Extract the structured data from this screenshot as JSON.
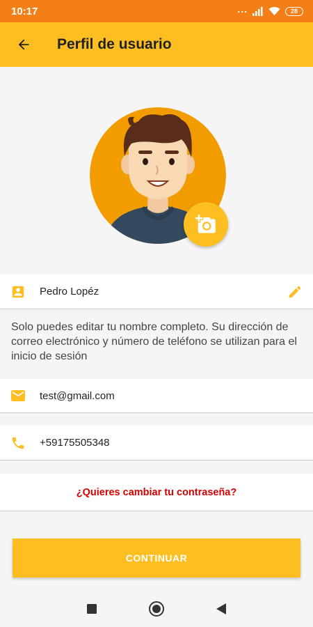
{
  "status_bar": {
    "time": "10:17",
    "dots": "...",
    "battery": "28"
  },
  "app_bar": {
    "title": "Perfil de usuario"
  },
  "profile": {
    "name": "Pedro Lopéz",
    "note": "Solo puedes editar tu nombre completo. Su dirección de correo electrónico y número de teléfono se utilizan para el inicio de sesión",
    "email": "test@gmail.com",
    "phone": "+59175505348"
  },
  "change_password_link": "¿Quieres cambiar tu contraseña?",
  "continue_button": "CONTINUAR",
  "icons": {
    "back": "arrow-back-icon",
    "camera": "add-a-photo-icon",
    "name": "contact-card-icon",
    "edit": "pencil-icon",
    "email": "mail-icon",
    "phone": "phone-icon",
    "nav_recent": "square-icon",
    "nav_home": "circle-icon",
    "nav_back": "triangle-back-icon"
  },
  "colors": {
    "status_bar": "#f57f17",
    "accent": "#fdbe22",
    "link": "#d50000",
    "avatar_background": "#f39c00"
  }
}
